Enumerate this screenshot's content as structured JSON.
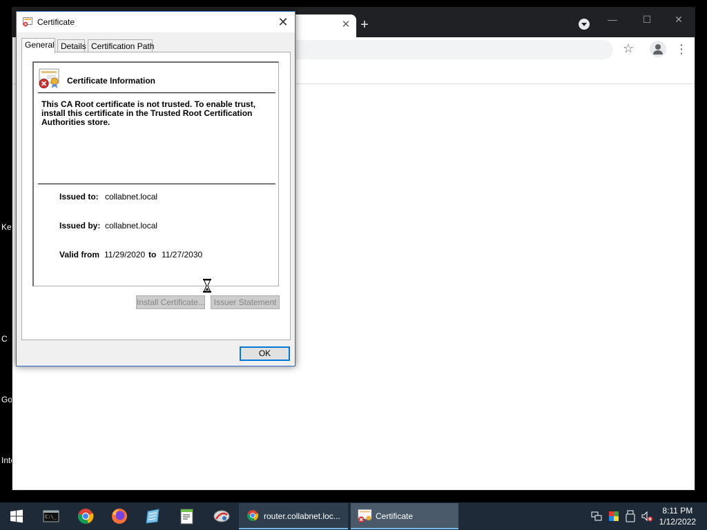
{
  "desktop": {
    "fragments": [
      "Key",
      "C",
      "Go",
      "Inte"
    ]
  },
  "browser": {
    "tab_close": "✕",
    "new_tab": "+",
    "controls": {
      "minimize": "—",
      "maximize": "☐",
      "close": "✕"
    },
    "star": "☆",
    "menu": "⋮"
  },
  "dialog": {
    "title": "Certificate",
    "close_glyph": "✕",
    "tabs": [
      "General",
      "Details",
      "Certification Path"
    ],
    "info_title": "Certificate Information",
    "message": "This CA Root certificate is not trusted. To enable trust, install this certificate in the Trusted Root Certification Authorities store.",
    "issued_to_label": "Issued to:",
    "issued_to": "collabnet.local",
    "issued_by_label": "Issued by:",
    "issued_by": "collabnet.local",
    "valid_from_label": "Valid from",
    "valid_from": "11/29/2020",
    "to_label": "to",
    "valid_to": "11/27/2030",
    "install_button": "Install Certificate...",
    "issuer_button": "Issuer Statement",
    "ok_button": "OK"
  },
  "taskbar": {
    "tasks": [
      {
        "label": "router.collabnet.loc..."
      },
      {
        "label": "Certificate"
      }
    ],
    "time": "8:11 PM",
    "date": "1/12/2022"
  }
}
